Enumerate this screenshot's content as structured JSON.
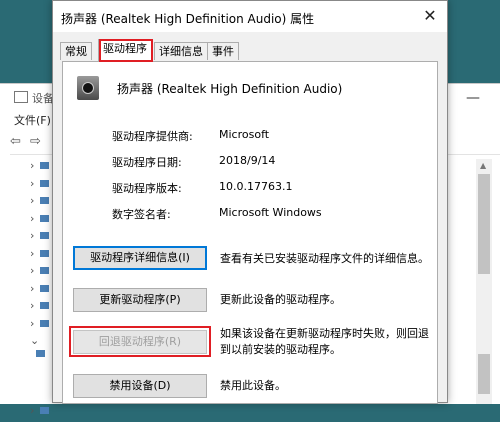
{
  "background_window": {
    "title": "设备",
    "menu": "文件(F)",
    "scroll_up_arrow": "▲"
  },
  "dialog": {
    "title": "扬声器 (Realtek High Definition Audio) 属性",
    "close_label": "✕",
    "tabs": [
      {
        "label": "常规"
      },
      {
        "label": "驱动程序"
      },
      {
        "label": "详细信息"
      },
      {
        "label": "事件"
      }
    ],
    "active_tab": "驱动程序",
    "device_name": "扬声器 (Realtek High Definition Audio)",
    "info": [
      {
        "label": "驱动程序提供商:",
        "value": "Microsoft"
      },
      {
        "label": "驱动程序日期:",
        "value": "2018/9/14"
      },
      {
        "label": "驱动程序版本:",
        "value": "10.0.17763.1"
      },
      {
        "label": "数字签名者:",
        "value": "Microsoft Windows"
      }
    ],
    "actions": [
      {
        "button": "驱动程序详细信息(I)",
        "description": "查看有关已安装驱动程序文件的详细信息。",
        "state": "focused"
      },
      {
        "button": "更新驱动程序(P)",
        "description": "更新此设备的驱动程序。",
        "state": "enabled"
      },
      {
        "button": "回退驱动程序(R)",
        "description": "如果该设备在更新驱动程序时失败，则回退到以前安装的驱动程序。",
        "state": "disabled"
      },
      {
        "button": "禁用设备(D)",
        "description": "禁用此设备。",
        "state": "enabled"
      }
    ]
  },
  "colors": {
    "highlight_red": "#e01e24",
    "focus_blue": "#0078d7",
    "dialog_bg": "#f0f0f0"
  }
}
